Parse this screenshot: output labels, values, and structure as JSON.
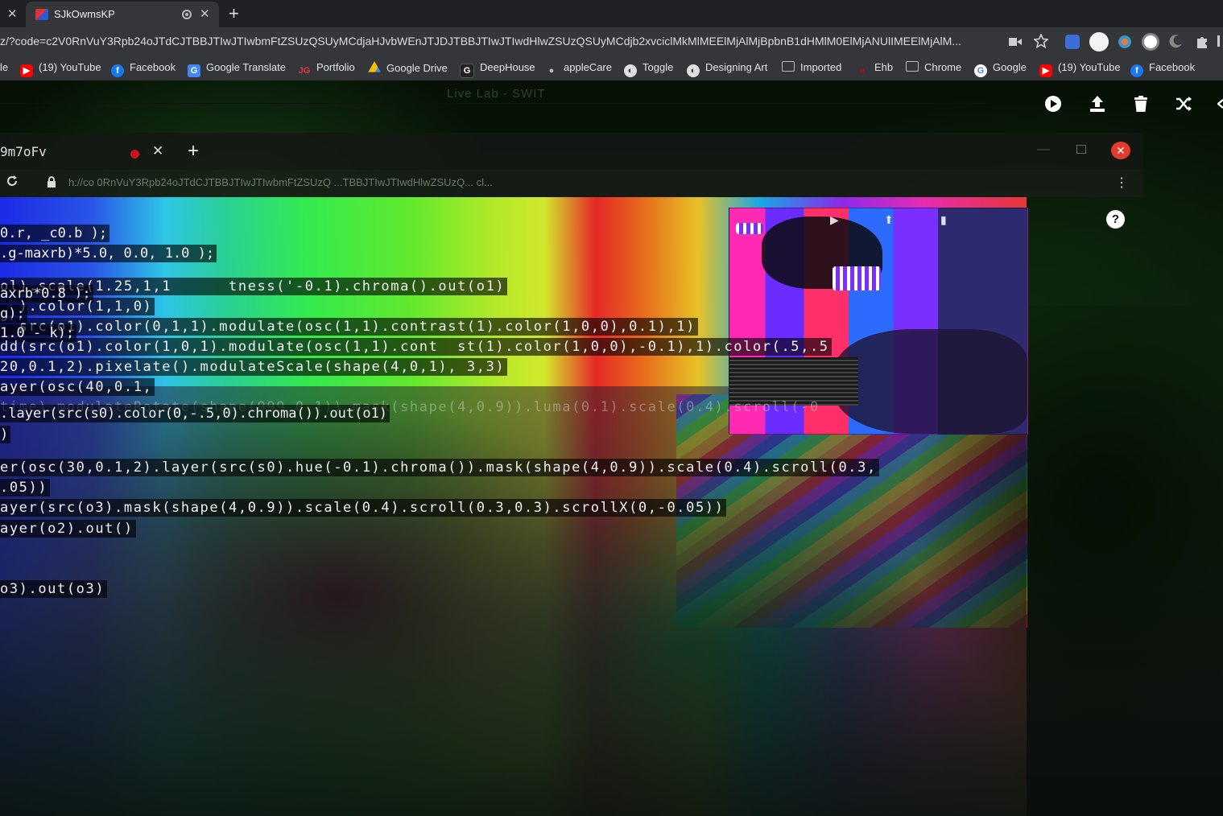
{
  "browser": {
    "tab_close_left": "✕",
    "tab_title": "SJkOwmsKP",
    "tab_close": "✕",
    "new_tab": "+",
    "url": "z/?code=c2V0RnVuY3Rpb24oJTdCJTBBJTIwJTIwbmFtZSUzQSUyMCdjaHJvbWEnJTJDJTBBJTIwJTIwdHlwZSUzQSUyMCdjb2xvciclMkMlMEElMjAlMjBpbnB1dHMlM0ElMjANUlIMEElMjAlM...",
    "bookmarks": [
      {
        "label": "le",
        "icon": "folder-icon",
        "color": "#35363a"
      },
      {
        "label": "(19) YouTube",
        "icon": "youtube-icon",
        "color": "#ff0000"
      },
      {
        "label": "Facebook",
        "icon": "facebook-icon",
        "color": "#1877f2"
      },
      {
        "label": "Google Translate",
        "icon": "translate-icon",
        "color": "#4285f4"
      },
      {
        "label": "Portfolio",
        "icon": "portfolio-icon",
        "color": "#e53935"
      },
      {
        "label": "Google Drive",
        "icon": "drive-icon",
        "color": "#34a853"
      },
      {
        "label": "DeepHouse",
        "icon": "deephouse-icon",
        "color": "#222222"
      },
      {
        "label": "appleCare",
        "icon": "apple-icon",
        "color": "#9e9e9e"
      },
      {
        "label": "Toggle",
        "icon": "toggle-icon",
        "color": "#e0e0e0"
      },
      {
        "label": "Designing Art",
        "icon": "globe-icon",
        "color": "#e0e0e0"
      },
      {
        "label": "Imported",
        "icon": "folder-icon",
        "color": "#9e9e9e"
      },
      {
        "label": "Ehb",
        "icon": "ehb-icon",
        "color": "#d50000"
      },
      {
        "label": "Chrome",
        "icon": "folder-icon",
        "color": "#9e9e9e"
      },
      {
        "label": "Google",
        "icon": "google-icon",
        "color": "#4285f4"
      },
      {
        "label": "(19) YouTube",
        "icon": "youtube-icon",
        "color": "#ff0000"
      },
      {
        "label": "Facebook",
        "icon": "facebook-icon",
        "color": "#1877f2"
      }
    ]
  },
  "hydra": {
    "ghost_title": "Live Lab - SWIT",
    "toolbar": [
      "play-icon",
      "upload-icon",
      "trash-icon",
      "shuffle-icon"
    ]
  },
  "inner_window": {
    "tab_title": "9m7oFv",
    "close": "✕",
    "new_tab": "+",
    "min": "—",
    "url": "h://co    0RnVuY3Rpb24oJTdCJTBBJTIwJTIwbmFtZSUzQ    ...TBBJTIwJTIwdHlwZSUzQ...   cl...",
    "help": "?"
  },
  "code_lines": [
    {
      "text": "0.r, _c0.b );",
      "style": "bg"
    },
    {
      "text": ".g-maxrb)*5.0, 0.0, 1.0 );",
      "style": "bg"
    },
    {
      "text": "ol).scale(1.25,1,1      tness('-0.1).chroma().out(o1)",
      "style": "bg wide"
    },
    {
      "text": "axrb*0.8 );",
      "style": "bg"
    },
    {
      "text": "  ).color(1,1,0)",
      "style": "bg wide"
    },
    {
      "text": "g);",
      "style": "bg"
    },
    {
      "text": "  src(o1).color(0,1,1).modulate(osc(1,1).contrast(1).color(1,0,0),0.1),1)",
      "style": "bg wide"
    },
    {
      "text": "1.0 - k);",
      "style": "bg"
    },
    {
      "text": "dd(src(o1).color(1,0,1).modulate(osc(1,1).cont  st(1).color(1,0,0),-0.1),1).color(.5,.5",
      "style": "bg wide"
    },
    {
      "text": "20,0.1,2).pixelate().modulateScale(shape(4,0,1), 3,3)",
      "style": "bg wide"
    },
    {
      "text": "ayer(osc(40,0.1,",
      "style": "bg wide"
    },
    {
      "text": "time).modulateRotate(shape(999,0.1)).mask(shape(4,0.9)).luma(0.1).scale(0.4).scroll(-0",
      "style": "faint wide"
    },
    {
      "text": ".layer(src(s0).color(0,-.5,0).chroma()).out(o1)",
      "style": "bg"
    },
    {
      "text": ")",
      "style": "bg"
    },
    {
      "text": "er(osc(30,0.1,2).layer(src(s0).hue(-0.1).chroma()).mask(shape(4,0.9)).scale(0.4).scroll(0.3,",
      "style": "bg wide"
    },
    {
      "text": ".05))",
      "style": "bg wide"
    },
    {
      "text": "ayer(src(o3).mask(shape(4,0.9)).scale(0.4).scroll(0.3,0.3).scrollX(0,-0.05))",
      "style": "bg wide"
    },
    {
      "text": "ayer(o2).out()",
      "style": "bg wide"
    },
    {
      "text": "o3).out(o3)",
      "style": "bg wide"
    }
  ]
}
